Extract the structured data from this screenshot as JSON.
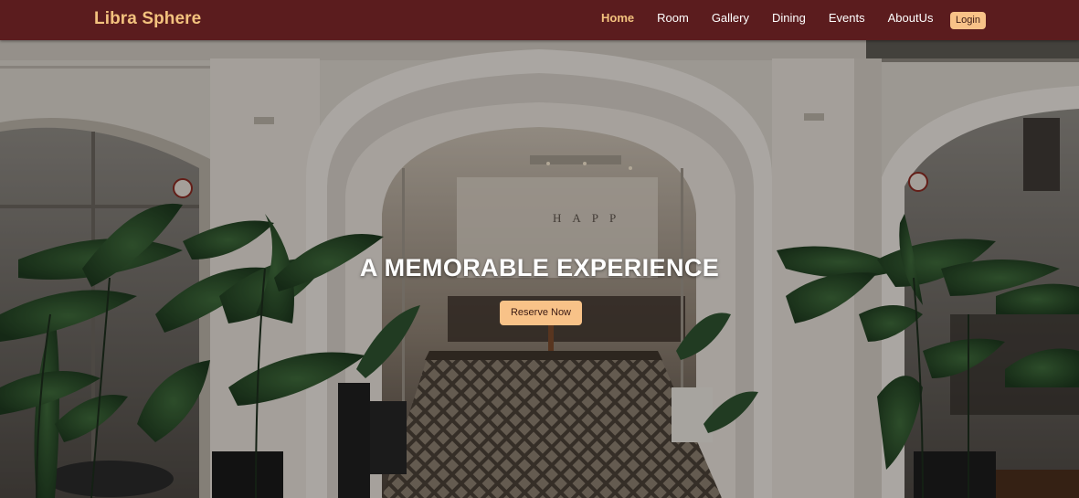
{
  "navbar": {
    "brand": "Libra Sphere",
    "links": [
      {
        "label": "Home",
        "active": true
      },
      {
        "label": "Room",
        "active": false
      },
      {
        "label": "Gallery",
        "active": false
      },
      {
        "label": "Dining",
        "active": false
      },
      {
        "label": "Events",
        "active": false
      },
      {
        "label": "AboutUs",
        "active": false
      }
    ],
    "login_label": "Login"
  },
  "hero": {
    "title": "A MEMORABLE EXPERIENCE",
    "cta_label": "Reserve Now",
    "background_image": "restaurant-entrance-photo",
    "signage_text": "HAPP"
  },
  "colors": {
    "navbar_bg": "#5b1c1e",
    "brand_color": "#f3c27e",
    "active_link": "#f3c27e",
    "button_bg": "#f8c288",
    "button_text": "#3b1b14"
  }
}
